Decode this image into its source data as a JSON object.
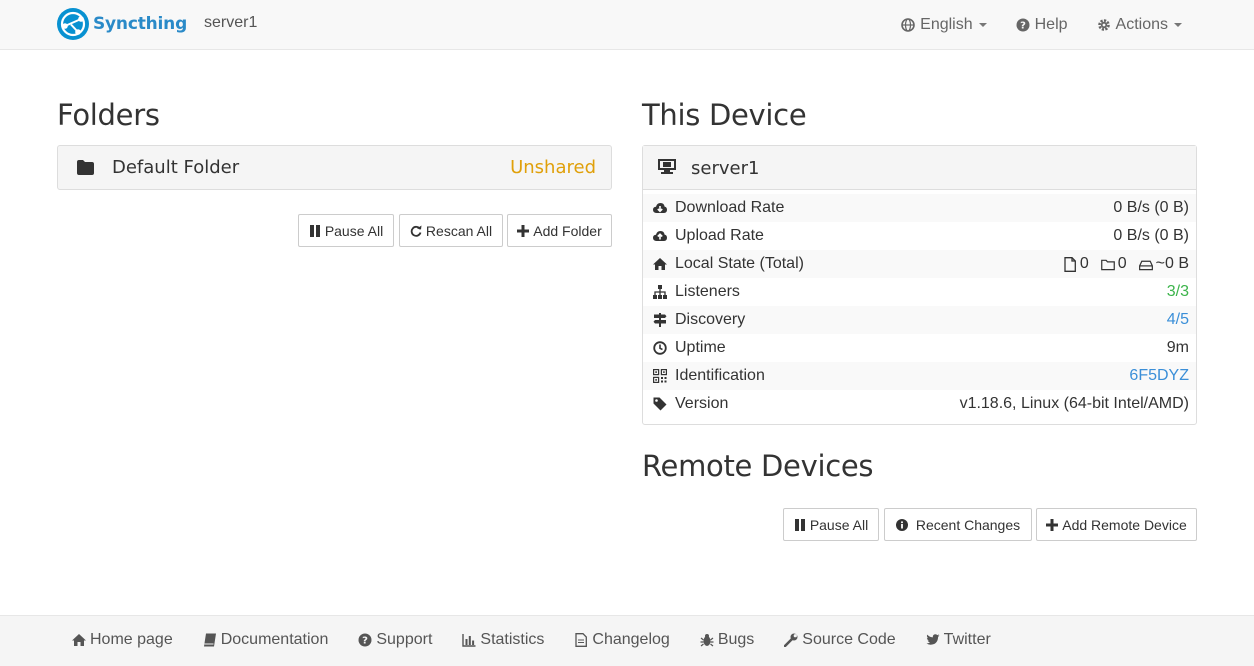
{
  "navbar": {
    "brand": "Syncthing",
    "device_name": "server1",
    "language": "English",
    "help": "Help",
    "actions": "Actions"
  },
  "folders": {
    "heading": "Folders",
    "items": [
      {
        "label": "Default Folder",
        "status": "Unshared",
        "status_color": "#e0a00a"
      }
    ],
    "buttons": {
      "pause_all": "Pause All",
      "rescan_all": "Rescan All",
      "add_folder": "Add Folder"
    }
  },
  "this_device": {
    "heading": "This Device",
    "name": "server1",
    "rows": [
      {
        "label": "Download Rate",
        "value": "0 B/s (0 B)",
        "icon": "cloud-download-icon"
      },
      {
        "label": "Upload Rate",
        "value": "0 B/s (0 B)",
        "icon": "cloud-upload-icon"
      },
      {
        "label": "Local State (Total)",
        "files": "0",
        "dirs": "0",
        "size": "~0 B",
        "icon": "home-icon"
      },
      {
        "label": "Listeners",
        "value": "3/3",
        "icon": "sitemap-icon",
        "color": "#3cb44b"
      },
      {
        "label": "Discovery",
        "value": "4/5",
        "icon": "signpost-icon",
        "color": "#3b8fd8"
      },
      {
        "label": "Uptime",
        "value": "9m",
        "icon": "clock-icon"
      },
      {
        "label": "Identification",
        "value": "6F5DYZ",
        "icon": "qrcode-icon",
        "color": "#3b8fd8"
      },
      {
        "label": "Version",
        "value": "v1.18.6, Linux (64-bit Intel/AMD)",
        "icon": "tag-icon"
      }
    ]
  },
  "remote_devices": {
    "heading": "Remote Devices",
    "buttons": {
      "pause_all": "Pause All",
      "recent_changes": "Recent Changes",
      "add_remote": "Add Remote Device"
    }
  },
  "footer": {
    "links": [
      "Home page",
      "Documentation",
      "Support",
      "Statistics",
      "Changelog",
      "Bugs",
      "Source Code",
      "Twitter"
    ]
  }
}
